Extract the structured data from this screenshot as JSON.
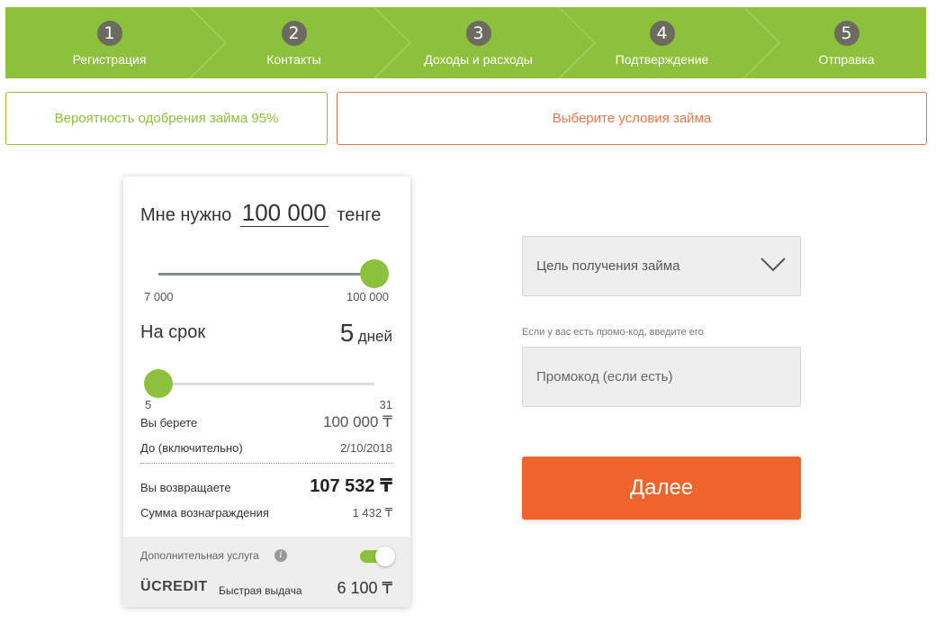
{
  "steps": [
    {
      "num": "1",
      "label": "Регистрация"
    },
    {
      "num": "2",
      "label": "Контакты"
    },
    {
      "num": "3",
      "label": "Доходы и расходы"
    },
    {
      "num": "4",
      "label": "Подтверждение"
    },
    {
      "num": "5",
      "label": "Отправка"
    }
  ],
  "approval": "Вероятность одобрения займа 95%",
  "conditions_title": "Выберите условия займа",
  "calculator": {
    "need_prefix": "Мне нужно",
    "amount": "100 000",
    "currency_word": "тенге",
    "amount_slider": {
      "min_label": "7 000",
      "max_label": "100 000",
      "level": 1.0
    },
    "term_label": "На срок",
    "term_value": "5",
    "term_unit": "дней",
    "term_slider": {
      "min_label": "5",
      "max_label": "31",
      "level": 0.0
    },
    "rows": [
      {
        "label": "Вы берете",
        "value": "100 000 ₸"
      },
      {
        "label": "До (включительно)",
        "value": "2/10/2018"
      },
      {
        "label": "Вы возвращаете",
        "value": "107 532 ₸"
      },
      {
        "label": "Сумма вознаграждения",
        "value": "1 432 ₸"
      }
    ],
    "extra_service": {
      "title": "Дополнительная услуга",
      "info_icon": "i",
      "enabled": true,
      "logo_text": "CREDIT",
      "description": "Быстрая выдача",
      "price": "6 100 ₸"
    }
  },
  "form": {
    "purpose_placeholder": "Цель получения займа",
    "promo_hint": "Если у вас есть промо-код, введите его",
    "promo_placeholder": "Промокод (если есть)",
    "next_label": "Далее"
  },
  "colors": {
    "brand_green": "#8dc03c",
    "accent_orange": "#f0632c",
    "step_circle": "#6b6b5f"
  }
}
